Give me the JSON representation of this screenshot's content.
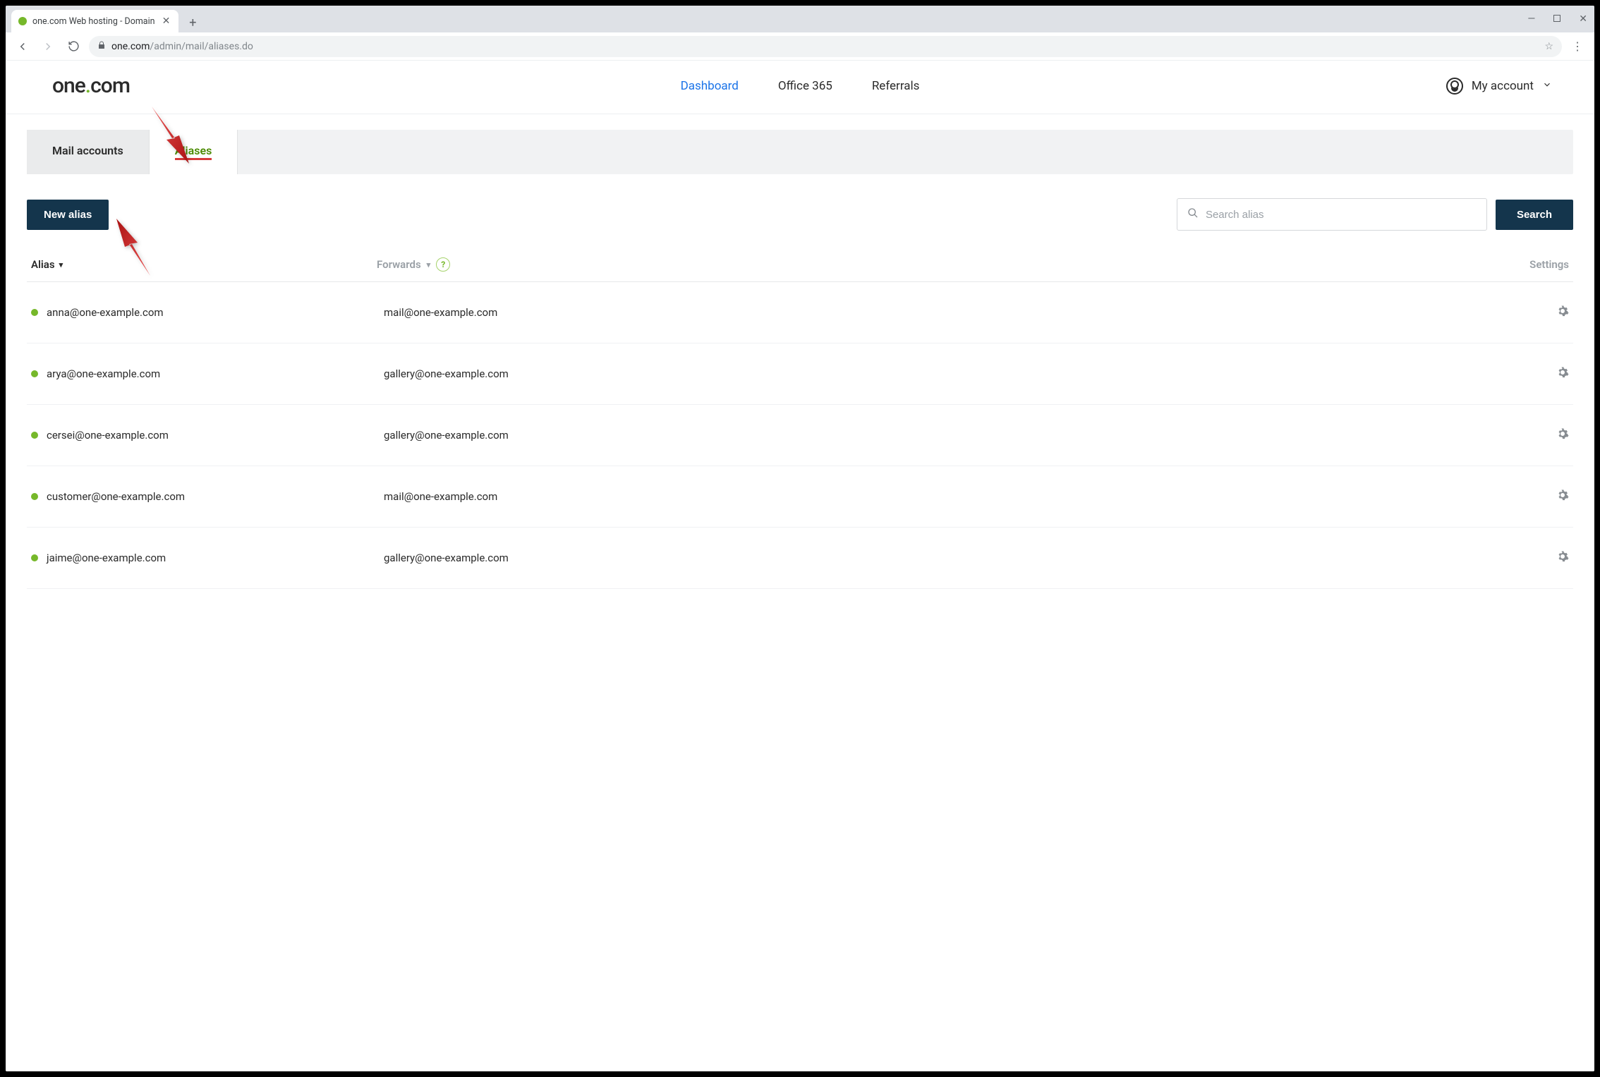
{
  "browser": {
    "tab_title": "one.com Web hosting  -  Domain",
    "url_domain": "one.com",
    "url_path": "/admin/mail/aliases.do"
  },
  "header": {
    "logo_a": "one",
    "logo_b": "com",
    "nav": {
      "dashboard": "Dashboard",
      "office365": "Office 365",
      "referrals": "Referrals"
    },
    "account_label": "My account"
  },
  "tabs": {
    "mail_accounts": "Mail accounts",
    "aliases": "Aliases"
  },
  "actions": {
    "new_alias": "New alias",
    "search_placeholder": "Search alias",
    "search_button": "Search"
  },
  "columns": {
    "alias": "Alias",
    "forwards": "Forwards",
    "settings": "Settings"
  },
  "rows": [
    {
      "alias": "anna@one-example.com",
      "forwards": "mail@one-example.com"
    },
    {
      "alias": "arya@one-example.com",
      "forwards": "gallery@one-example.com"
    },
    {
      "alias": "cersei@one-example.com",
      "forwards": "gallery@one-example.com"
    },
    {
      "alias": "customer@one-example.com",
      "forwards": "mail@one-example.com"
    },
    {
      "alias": "jaime@one-example.com",
      "forwards": "gallery@one-example.com"
    }
  ]
}
